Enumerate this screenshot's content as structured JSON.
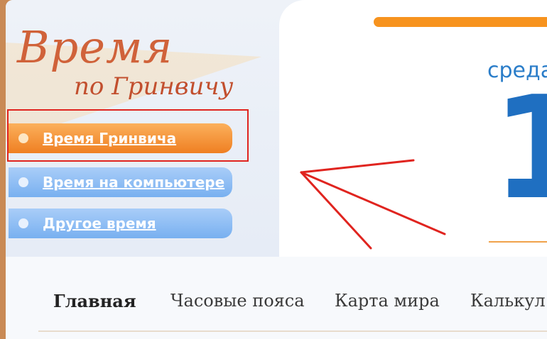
{
  "logo": {
    "line1": "Время",
    "line2": "по Гринвичу"
  },
  "menu": {
    "items": [
      {
        "label": "Время Гринвича",
        "active": true
      },
      {
        "label": "Время на компьютере",
        "active": false
      },
      {
        "label": "Другое время",
        "active": false
      }
    ]
  },
  "clock": {
    "day": "среда",
    "digit": "1"
  },
  "nav": {
    "items": [
      {
        "label": "Главная",
        "active": true
      },
      {
        "label": "Часовые пояса",
        "active": false
      },
      {
        "label": "Карта мира",
        "active": false
      },
      {
        "label": "Калькул",
        "active": false
      }
    ]
  },
  "colors": {
    "accent_orange": "#f7931e",
    "accent_blue": "#1f6fc1",
    "annotation_red": "#e0241f"
  }
}
